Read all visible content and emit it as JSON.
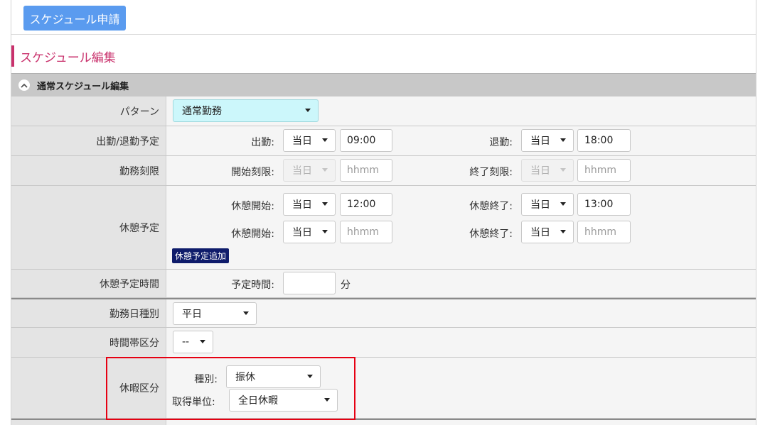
{
  "header": {
    "apply_button": "スケジュール申請"
  },
  "section": {
    "title": "スケジュール編集"
  },
  "panel": {
    "title": "通常スケジュール編集"
  },
  "rows": {
    "pattern": {
      "label": "パターン",
      "value": "通常勤務"
    },
    "attendance": {
      "label": "出勤/退勤予定",
      "start_label": "出勤:",
      "start_day": "当日",
      "start_time": "09:00",
      "end_label": "退勤:",
      "end_day": "当日",
      "end_time": "18:00"
    },
    "limit": {
      "label": "勤務刻限",
      "start_label": "開始刻限:",
      "start_day": "当日",
      "start_placeholder": "hhmm",
      "end_label": "終了刻限:",
      "end_day": "当日",
      "end_placeholder": "hhmm"
    },
    "break": {
      "label": "休憩予定",
      "b1_start_label": "休憩開始:",
      "b1_start_day": "当日",
      "b1_start_time": "12:00",
      "b1_end_label": "休憩終了:",
      "b1_end_day": "当日",
      "b1_end_time": "13:00",
      "b2_start_label": "休憩開始:",
      "b2_start_day": "当日",
      "b2_start_placeholder": "hhmm",
      "b2_end_label": "休憩終了:",
      "b2_end_day": "当日",
      "b2_end_placeholder": "hhmm",
      "add_button": "休憩予定追加"
    },
    "break_time": {
      "label": "休憩予定時間",
      "field_label": "予定時間:",
      "value": "",
      "unit": "分"
    },
    "workday_type": {
      "label": "勤務日種別",
      "value": "平日"
    },
    "time_zone": {
      "label": "時間帯区分",
      "value": "--"
    },
    "leave": {
      "label": "休暇区分",
      "type_label": "種別:",
      "type_value": "振休",
      "unit_label": "取得単位:",
      "unit_value": "全日休暇"
    }
  },
  "colors": {
    "accent": "#5a9bef",
    "section": "#c9316c",
    "highlight_box": "#e60012",
    "add_button": "#0f1c6b"
  }
}
